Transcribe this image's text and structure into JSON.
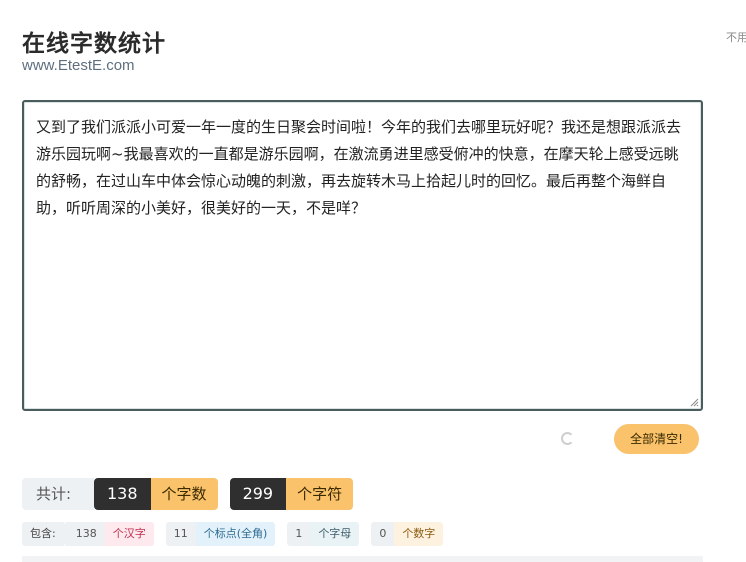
{
  "header": {
    "title": "在线字数统计",
    "url": "www.EtestE.com",
    "side_note": "不用"
  },
  "editor": {
    "text": "又到了我们派派小可爱一年一度的生日聚会时间啦！今年的我们去哪里玩好呢？我还是想跟派派去游乐园玩啊~我最喜欢的一直都是游乐园啊，在激流勇进里感受俯冲的快意，在摩天轮上感受远眺的舒畅，在过山车中体会惊心动魄的刺激，再去旋转木马上拾起儿时的回忆。最后再整个海鲜自助，听听周深的小美好，很美好的一天，不是咩？"
  },
  "actions": {
    "clear_label": "全部清空!"
  },
  "totals": {
    "label": "共计:",
    "word_count": "138",
    "word_unit": "个字数",
    "char_count": "299",
    "char_unit": "个字符"
  },
  "breakdown": {
    "label": "包含:",
    "han_count": "138",
    "han_unit": "个汉字",
    "punct_count": "11",
    "punct_unit": "个标点(全角)",
    "letter_count": "1",
    "letter_unit": "个字母",
    "digit_count": "0",
    "digit_unit": "个数字"
  },
  "colors": {
    "accent": "#f9c26b",
    "dark": "#2f2f2f",
    "editor_border": "#4a5c5c"
  }
}
